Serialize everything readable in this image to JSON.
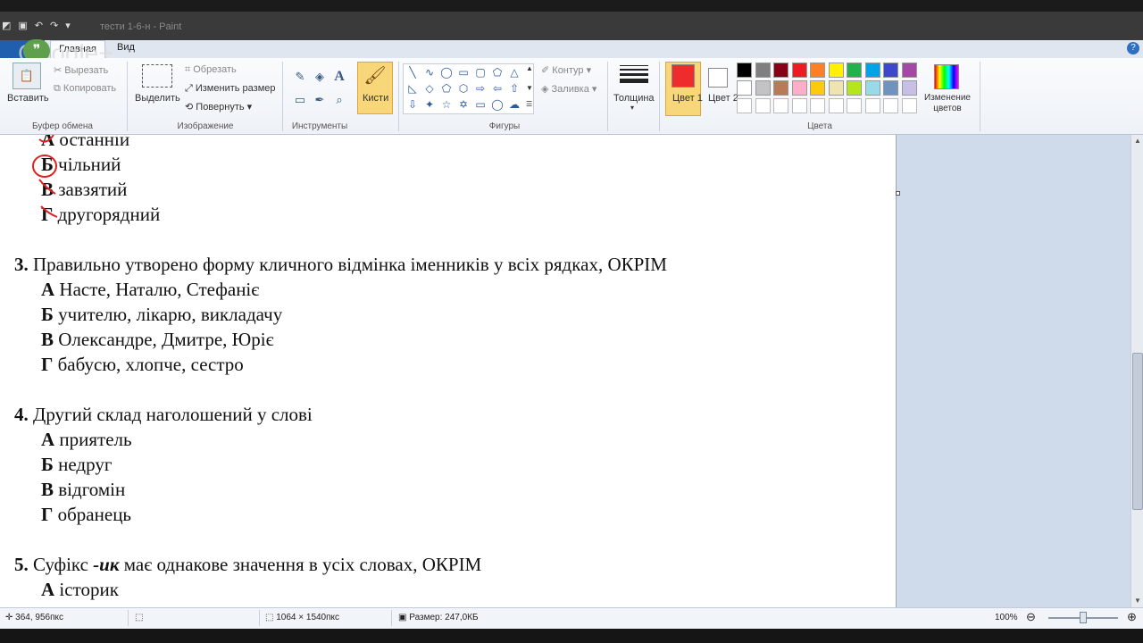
{
  "app": {
    "window_title": "тести 1-6-н - Paint"
  },
  "quick_access": {
    "undo": "↶",
    "redo": "↷"
  },
  "overlay": {
    "brand": "Google+"
  },
  "tabs": {
    "home": "Главная",
    "view": "Вид"
  },
  "ribbon": {
    "clipboard": {
      "paste": "Вставить",
      "cut": "Вырезать",
      "copy": "Копировать",
      "group": "Буфер обмена"
    },
    "image": {
      "select": "Выделить",
      "crop": "Обрезать",
      "resize": "Изменить размер",
      "rotate": "Повернуть",
      "group": "Изображение"
    },
    "tools": {
      "group": "Инструменты"
    },
    "brushes": {
      "label": "Кисти"
    },
    "shapes": {
      "outline": "Контур",
      "fill": "Заливка",
      "group": "Фигуры"
    },
    "thickness": {
      "label": "Толщина"
    },
    "colors": {
      "color1": "Цвет 1",
      "color2": "Цвет 2",
      "edit": "Изменение цветов",
      "group": "Цвета",
      "color1_value": "#ee2c2c",
      "color2_value": "#ffffff",
      "palette_row1": [
        "#000000",
        "#7f7f7f",
        "#880015",
        "#ed1c24",
        "#ff7f27",
        "#fff200",
        "#22b14c",
        "#00a2e8",
        "#3f48cc",
        "#a349a4"
      ],
      "palette_row2": [
        "#ffffff",
        "#c3c3c3",
        "#b97a57",
        "#ffaec9",
        "#ffc90e",
        "#efe4b0",
        "#b5e61d",
        "#99d9ea",
        "#7092be",
        "#c8bfe7"
      ]
    }
  },
  "document": {
    "q2_options": [
      {
        "letter": "А",
        "text": "останній"
      },
      {
        "letter": "Б",
        "text": "чільний"
      },
      {
        "letter": "В",
        "text": "завзятий"
      },
      {
        "letter": "Г",
        "text": "другорядний"
      }
    ],
    "q3": {
      "num": "3.",
      "text": "Правильно утворено форму кличного відмінка іменників у всіх рядках, ОКРІМ",
      "options": [
        {
          "letter": "А",
          "text": "Насте, Наталю, Стефаніє"
        },
        {
          "letter": "Б",
          "text": "учителю, лікарю, викладачу"
        },
        {
          "letter": "В",
          "text": "Олександре, Дмитре, Юріє"
        },
        {
          "letter": "Г",
          "text": "бабусю, хлопче, сестро"
        }
      ]
    },
    "q4": {
      "num": "4.",
      "text": "Другий склад наголошений у слові",
      "options": [
        {
          "letter": "А",
          "text": "приятель"
        },
        {
          "letter": "Б",
          "text": "недруг"
        },
        {
          "letter": "В",
          "text": "відгомін"
        },
        {
          "letter": "Г",
          "text": "обранець"
        }
      ]
    },
    "q5": {
      "num": "5.",
      "text_before": "Суфікс ",
      "suffix": "-ик",
      "text_after": " має однакове значення в усіх словах, ОКРІМ",
      "options": [
        {
          "letter": "А",
          "text": "історик"
        }
      ]
    }
  },
  "status": {
    "cursor": "364, 956пкс",
    "dimensions": "1064 × 1540пкс",
    "size": "Размер: 247,0КБ",
    "zoom": "100%",
    "zoom_out": "⊖",
    "zoom_in": "⊕",
    "zoom_level_fraction": 0.5
  }
}
